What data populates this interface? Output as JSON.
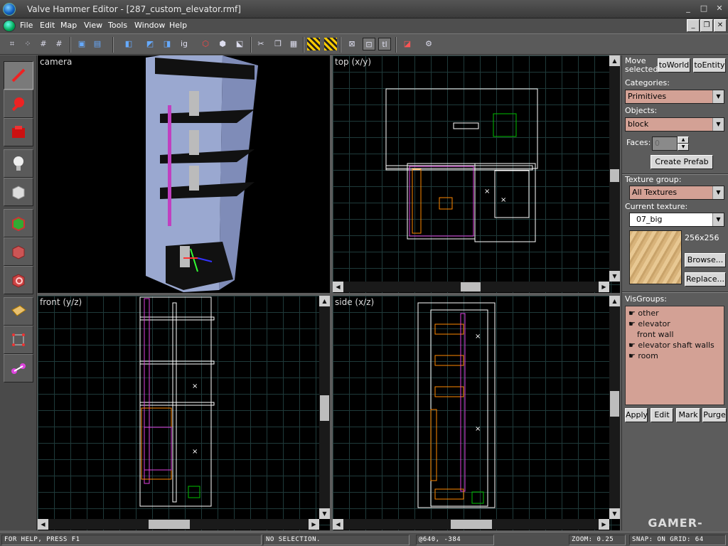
{
  "window": {
    "title": "Valve Hammer Editor - [287_custom_elevator.rmf]",
    "minimize": "_",
    "maximize": "□",
    "close": "✕"
  },
  "menu": [
    "File",
    "Edit",
    "Map",
    "View",
    "Tools",
    "Window",
    "Help"
  ],
  "viewports": {
    "camera": "camera",
    "top": "top (x/y)",
    "front": "front (y/z)",
    "side": "side (x/z)"
  },
  "right_panel": {
    "move_selected_label": "Move\nselected:",
    "to_world": "toWorld",
    "to_entity": "toEntity",
    "categories_label": "Categories:",
    "categories_value": "Primitives",
    "objects_label": "Objects:",
    "objects_value": "block",
    "faces_label": "Faces:",
    "faces_value": "0",
    "create_prefab": "Create Prefab",
    "texture_group_label": "Texture group:",
    "texture_group_value": "All Textures",
    "current_texture_label": "Current texture:",
    "current_texture_value": "07_big",
    "texture_size": "256x256",
    "browse": "Browse...",
    "replace": "Replace...",
    "visgroups_label": "VisGroups:",
    "visgroups": [
      {
        "name": "other",
        "checked": true
      },
      {
        "name": "elevator",
        "checked": true
      },
      {
        "name": "front wall",
        "checked": false
      },
      {
        "name": "elevator shaft walls",
        "checked": true
      },
      {
        "name": "room",
        "checked": true
      }
    ],
    "apply": "Apply",
    "edit": "Edit",
    "mark": "Mark",
    "purge": "Purge"
  },
  "status": {
    "help": "FOR HELP, PRESS F1",
    "selection": "NO SELECTION.",
    "coords": "@640, -384",
    "zoom": "ZOOM: 0.25",
    "snap": "SNAP: ON GRID: 64"
  },
  "watermark": "GAMER-LAB.COM",
  "colors": {
    "panel": "#5c5c5c",
    "combo_bg": "#d3a195",
    "grid": "#1f3a3a",
    "brush_white": "#ffffff",
    "brush_magenta": "#e040e0",
    "brush_orange": "#ff8800",
    "selection_green": "#00c000"
  }
}
